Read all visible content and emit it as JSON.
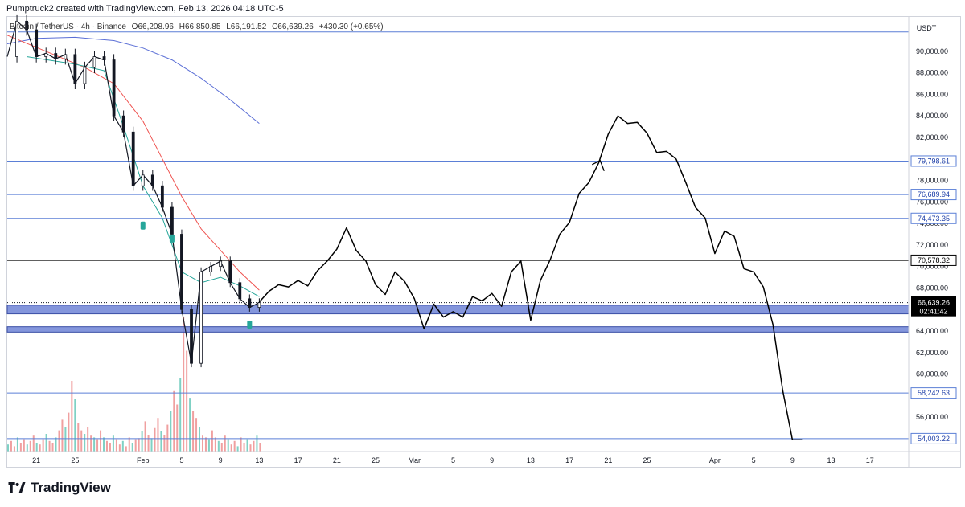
{
  "header": {
    "created_by": "Pumptruck2 created with TradingView.com, Feb 13, 2026 04:18 UTC-5"
  },
  "symbol_bar": {
    "symbol": "Bitcoin / TetherUS · 4h · Binance",
    "open": "O66,208.96",
    "high": "H66,850.85",
    "low": "L66,191.52",
    "close": "C66,639.26",
    "change": "+430.30 (+0.65%)"
  },
  "currency": "USDT",
  "footer": {
    "brand": "TradingView"
  },
  "colors": {
    "ema_fast": "#26a69a",
    "ema_mid": "#ef5350",
    "ema_slow": "#5b6fd6",
    "level_line": "#5b7fd6",
    "zone_fill": "#6f84d6",
    "candle_up": "#131722",
    "candle_down": "#131722",
    "volume_up": "#7fd1c4",
    "volume_down": "#f0a0a0",
    "marker": "#26a69a"
  },
  "chart_data": {
    "type": "line",
    "title": "",
    "y_axis": {
      "unit": "USDT",
      "ylim": [
        52800,
        93200
      ],
      "ticks": [
        54000,
        56000,
        58000,
        60000,
        62000,
        64000,
        66000,
        68000,
        70000,
        72000,
        74000,
        76000,
        78000,
        80000,
        82000,
        84000,
        86000,
        88000,
        90000
      ],
      "tick_labels": [
        "54,000.00",
        "56,000.00",
        "58,000.00",
        "60,000.00",
        "62,000.00",
        "64,000.00",
        "66,000.00",
        "68,000.00",
        "70,000.00",
        "72,000.00",
        "74,000.00",
        "76,000.00",
        "78,000.00",
        "80,000.00",
        "82,000.00",
        "84,000.00",
        "86,000.00",
        "88,000.00",
        "90,000.00"
      ]
    },
    "x_axis": {
      "xlim": [
        "2026-01-18",
        "2026-04-21"
      ],
      "ticks": [
        "2026-01-21",
        "2026-01-25",
        "2026-02-01",
        "2026-02-05",
        "2026-02-09",
        "2026-02-13",
        "2026-02-17",
        "2026-02-21",
        "2026-02-25",
        "2026-03-01",
        "2026-03-05",
        "2026-03-09",
        "2026-03-13",
        "2026-03-17",
        "2026-03-21",
        "2026-03-25",
        "2026-04-01",
        "2026-04-05",
        "2026-04-09",
        "2026-04-13",
        "2026-04-17"
      ],
      "tick_labels": [
        "21",
        "25",
        "Feb",
        "5",
        "9",
        "13",
        "17",
        "21",
        "25",
        "Mar",
        "5",
        "9",
        "13",
        "17",
        "21",
        "25",
        "Apr",
        "5",
        "9",
        "13",
        "17"
      ]
    },
    "price_levels": [
      {
        "value": 79798.61,
        "label": "79,798.61",
        "color": "#5b7fd6"
      },
      {
        "value": 76689.94,
        "label": "76,689.94",
        "color": "#5b7fd6"
      },
      {
        "value": 74473.35,
        "label": "74,473.35",
        "color": "#5b7fd6"
      },
      {
        "value": 70578.32,
        "label": "70,578.32",
        "color": "#000000"
      },
      {
        "value": 58242.63,
        "label": "58,242.63",
        "color": "#5b7fd6"
      },
      {
        "value": 54003.22,
        "label": "54,003.22",
        "color": "#5b7fd6"
      }
    ],
    "top_level": 91800,
    "zones": [
      {
        "from": 65600,
        "to": 66400
      },
      {
        "from": 63900,
        "to": 64400
      }
    ],
    "current_price": {
      "value": 66639.26,
      "label": "66,639.26",
      "countdown": "02:41:42"
    },
    "price_history": {
      "name": "",
      "points": [
        [
          "2026-01-18",
          89500
        ],
        [
          "2026-01-19",
          92800
        ],
        [
          "2026-01-20",
          92000
        ],
        [
          "2026-01-21",
          89500
        ],
        [
          "2026-01-22",
          89800
        ],
        [
          "2026-01-23",
          89300
        ],
        [
          "2026-01-24",
          89700
        ],
        [
          "2026-01-25",
          87000
        ],
        [
          "2026-01-26",
          88500
        ],
        [
          "2026-01-27",
          89500
        ],
        [
          "2026-01-28",
          89200
        ],
        [
          "2026-01-29",
          84000
        ],
        [
          "2026-01-30",
          82500
        ],
        [
          "2026-01-31",
          77500
        ],
        [
          "2026-02-01",
          78500
        ],
        [
          "2026-02-02",
          77500
        ],
        [
          "2026-02-03",
          75500
        ],
        [
          "2026-02-04",
          73000
        ],
        [
          "2026-02-05",
          66000
        ],
        [
          "2026-02-06",
          61000
        ],
        [
          "2026-02-07",
          69500
        ],
        [
          "2026-02-08",
          70000
        ],
        [
          "2026-02-09",
          70500
        ],
        [
          "2026-02-10",
          68500
        ],
        [
          "2026-02-11",
          67000
        ],
        [
          "2026-02-12",
          66200
        ],
        [
          "2026-02-13",
          66639
        ]
      ]
    },
    "ema_fast": [
      [
        "2026-01-20",
        89500
      ],
      [
        "2026-01-25",
        88800
      ],
      [
        "2026-01-28",
        88200
      ],
      [
        "2026-01-30",
        83000
      ],
      [
        "2026-02-01",
        77500
      ],
      [
        "2026-02-03",
        74500
      ],
      [
        "2026-02-05",
        69500
      ],
      [
        "2026-02-07",
        68500
      ],
      [
        "2026-02-09",
        69000
      ],
      [
        "2026-02-11",
        68200
      ],
      [
        "2026-02-13",
        67200
      ]
    ],
    "ema_mid": [
      [
        "2026-01-18",
        91500
      ],
      [
        "2026-01-22",
        90000
      ],
      [
        "2026-01-26",
        88500
      ],
      [
        "2026-01-29",
        87000
      ],
      [
        "2026-02-01",
        83500
      ],
      [
        "2026-02-03",
        80000
      ],
      [
        "2026-02-05",
        76500
      ],
      [
        "2026-02-07",
        73500
      ],
      [
        "2026-02-09",
        71500
      ],
      [
        "2026-02-11",
        69500
      ],
      [
        "2026-02-13",
        67800
      ]
    ],
    "ema_slow": [
      [
        "2026-01-18",
        90700
      ],
      [
        "2026-01-21",
        91200
      ],
      [
        "2026-01-25",
        91300
      ],
      [
        "2026-01-29",
        91000
      ],
      [
        "2026-02-01",
        90300
      ],
      [
        "2026-02-04",
        89200
      ],
      [
        "2026-02-07",
        87500
      ],
      [
        "2026-02-10",
        85500
      ],
      [
        "2026-02-13",
        83300
      ]
    ],
    "projection": {
      "name": "",
      "points": [
        [
          "2026-02-13",
          66700
        ],
        [
          "2026-02-14",
          67700
        ],
        [
          "2026-02-15",
          68300
        ],
        [
          "2026-02-16",
          68100
        ],
        [
          "2026-02-17",
          68700
        ],
        [
          "2026-02-18",
          68200
        ],
        [
          "2026-02-19",
          69600
        ],
        [
          "2026-02-20",
          70500
        ],
        [
          "2026-02-21",
          71600
        ],
        [
          "2026-02-22",
          73600
        ],
        [
          "2026-02-23",
          71500
        ],
        [
          "2026-02-24",
          70500
        ],
        [
          "2026-02-25",
          68300
        ],
        [
          "2026-02-26",
          67400
        ],
        [
          "2026-02-27",
          69500
        ],
        [
          "2026-02-28",
          68600
        ],
        [
          "2026-03-01",
          67000
        ],
        [
          "2026-03-02",
          64200
        ],
        [
          "2026-03-03",
          66500
        ],
        [
          "2026-03-04",
          65300
        ],
        [
          "2026-03-05",
          65800
        ],
        [
          "2026-03-06",
          65300
        ],
        [
          "2026-03-07",
          67200
        ],
        [
          "2026-03-08",
          66800
        ],
        [
          "2026-03-09",
          67500
        ],
        [
          "2026-03-10",
          66300
        ],
        [
          "2026-03-11",
          69500
        ],
        [
          "2026-03-12",
          70500
        ],
        [
          "2026-03-13",
          65000
        ],
        [
          "2026-03-14",
          68700
        ],
        [
          "2026-03-15",
          70600
        ],
        [
          "2026-03-16",
          73000
        ],
        [
          "2026-03-17",
          74100
        ],
        [
          "2026-03-18",
          76800
        ],
        [
          "2026-03-19",
          77800
        ],
        [
          "2026-03-20",
          79600
        ],
        [
          "2026-03-21",
          82300
        ],
        [
          "2026-03-22",
          84000
        ],
        [
          "2026-03-23",
          83300
        ],
        [
          "2026-03-24",
          83400
        ],
        [
          "2026-03-25",
          82400
        ],
        [
          "2026-03-26",
          80600
        ],
        [
          "2026-03-27",
          80700
        ],
        [
          "2026-03-28",
          80000
        ],
        [
          "2026-03-29",
          77800
        ],
        [
          "2026-03-30",
          75500
        ],
        [
          "2026-03-31",
          74500
        ],
        [
          "2026-04-01",
          71200
        ],
        [
          "2026-04-02",
          73300
        ],
        [
          "2026-04-03",
          72800
        ],
        [
          "2026-04-04",
          69800
        ],
        [
          "2026-04-05",
          69500
        ],
        [
          "2026-04-06",
          68100
        ],
        [
          "2026-04-07",
          64600
        ],
        [
          "2026-04-08",
          58500
        ],
        [
          "2026-04-09",
          53900
        ]
      ]
    }
  }
}
